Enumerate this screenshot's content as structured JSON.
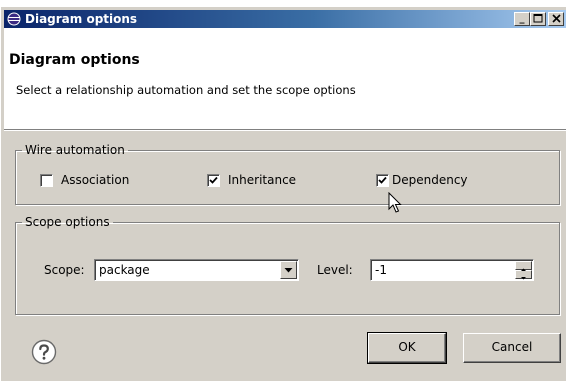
{
  "window": {
    "title": "Diagram options",
    "app_icon": "eclipse-icon",
    "controls": [
      "minimize",
      "maximize",
      "close"
    ]
  },
  "header": {
    "title": "Diagram options",
    "description": "Select a relationship automation and set the scope options"
  },
  "wire_automation": {
    "legend": "Wire automation",
    "options": [
      {
        "label": "Association",
        "checked": false
      },
      {
        "label": "Inheritance",
        "checked": true
      },
      {
        "label": "Dependency",
        "checked": true
      }
    ]
  },
  "scope_options": {
    "legend": "Scope options",
    "scope_label": "Scope:",
    "scope_value": "package",
    "level_label": "Level:",
    "level_value": "-1"
  },
  "footer": {
    "help_icon": "help-icon",
    "ok_label": "OK",
    "cancel_label": "Cancel"
  },
  "colors": {
    "dialog_bg": "#d4d0c8",
    "title_start": "#0a246a",
    "title_end": "#a6caf0",
    "header_bg": "#ffffff"
  }
}
